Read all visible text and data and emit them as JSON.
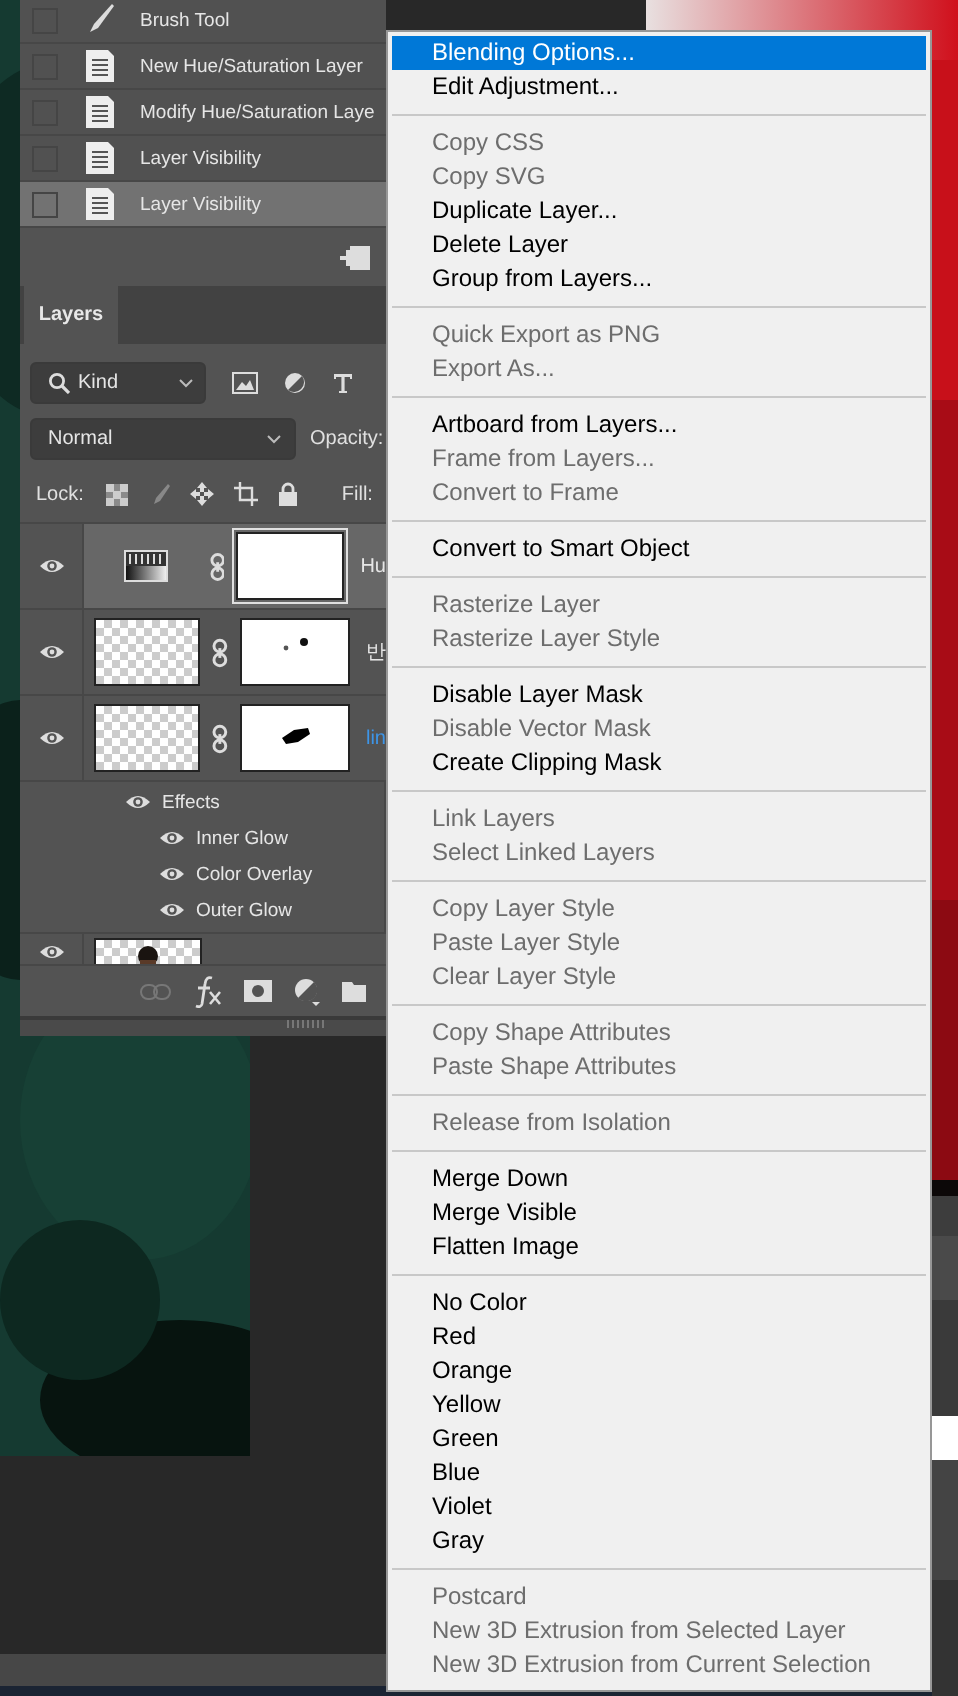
{
  "history": {
    "items": [
      {
        "label": "Brush Tool",
        "kind": "brush",
        "selected": false
      },
      {
        "label": "New Hue/Saturation Layer",
        "kind": "document",
        "selected": false
      },
      {
        "label": "Modify Hue/Saturation Laye",
        "kind": "document",
        "selected": false
      },
      {
        "label": "Layer Visibility",
        "kind": "document",
        "selected": false
      },
      {
        "label": "Layer Visibility",
        "kind": "document",
        "selected": true
      }
    ]
  },
  "layers_panel": {
    "tab": "Layers",
    "filter": "Kind",
    "blend_mode": "Normal",
    "opacity_label": "Opacity:",
    "lock_label": "Lock:",
    "fill_label": "Fill:",
    "layers": [
      {
        "kind": "adjustment",
        "name": "Hu",
        "visible": true,
        "selected": true,
        "highlighted": false
      },
      {
        "kind": "dots-mask",
        "name": "반",
        "visible": true,
        "selected": false,
        "highlighted": false
      },
      {
        "kind": "blob-mask",
        "name": "lin",
        "visible": true,
        "selected": false,
        "highlighted": true,
        "effects_label": "Effects",
        "effects": [
          "Inner Glow",
          "Color Overlay",
          "Outer Glow"
        ]
      },
      {
        "kind": "pixel",
        "visible": true,
        "selected": false
      }
    ]
  },
  "context_menu": {
    "groups": [
      [
        {
          "label": "Blending Options...",
          "disabled": false,
          "selected": true
        },
        {
          "label": "Edit Adjustment...",
          "disabled": false,
          "selected": false
        }
      ],
      [
        {
          "label": "Copy CSS",
          "disabled": true,
          "selected": false
        },
        {
          "label": "Copy SVG",
          "disabled": true,
          "selected": false
        },
        {
          "label": "Duplicate Layer...",
          "disabled": false,
          "selected": false
        },
        {
          "label": "Delete Layer",
          "disabled": false,
          "selected": false
        },
        {
          "label": "Group from Layers...",
          "disabled": false,
          "selected": false
        }
      ],
      [
        {
          "label": "Quick Export as PNG",
          "disabled": true,
          "selected": false
        },
        {
          "label": "Export As...",
          "disabled": true,
          "selected": false
        }
      ],
      [
        {
          "label": "Artboard from Layers...",
          "disabled": false,
          "selected": false
        },
        {
          "label": "Frame from Layers...",
          "disabled": true,
          "selected": false
        },
        {
          "label": "Convert to Frame",
          "disabled": true,
          "selected": false
        }
      ],
      [
        {
          "label": "Convert to Smart Object",
          "disabled": false,
          "selected": false
        }
      ],
      [
        {
          "label": "Rasterize Layer",
          "disabled": true,
          "selected": false
        },
        {
          "label": "Rasterize Layer Style",
          "disabled": true,
          "selected": false
        }
      ],
      [
        {
          "label": "Disable Layer Mask",
          "disabled": false,
          "selected": false
        },
        {
          "label": "Disable Vector Mask",
          "disabled": true,
          "selected": false
        },
        {
          "label": "Create Clipping Mask",
          "disabled": false,
          "selected": false
        }
      ],
      [
        {
          "label": "Link Layers",
          "disabled": true,
          "selected": false
        },
        {
          "label": "Select Linked Layers",
          "disabled": true,
          "selected": false
        }
      ],
      [
        {
          "label": "Copy Layer Style",
          "disabled": true,
          "selected": false
        },
        {
          "label": "Paste Layer Style",
          "disabled": true,
          "selected": false
        },
        {
          "label": "Clear Layer Style",
          "disabled": true,
          "selected": false
        }
      ],
      [
        {
          "label": "Copy Shape Attributes",
          "disabled": true,
          "selected": false
        },
        {
          "label": "Paste Shape Attributes",
          "disabled": true,
          "selected": false
        }
      ],
      [
        {
          "label": "Release from Isolation",
          "disabled": true,
          "selected": false
        }
      ],
      [
        {
          "label": "Merge Down",
          "disabled": false,
          "selected": false
        },
        {
          "label": "Merge Visible",
          "disabled": false,
          "selected": false
        },
        {
          "label": "Flatten Image",
          "disabled": false,
          "selected": false
        }
      ],
      [
        {
          "label": "No Color",
          "disabled": false,
          "selected": false
        },
        {
          "label": "Red",
          "disabled": false,
          "selected": false
        },
        {
          "label": "Orange",
          "disabled": false,
          "selected": false
        },
        {
          "label": "Yellow",
          "disabled": false,
          "selected": false
        },
        {
          "label": "Green",
          "disabled": false,
          "selected": false
        },
        {
          "label": "Blue",
          "disabled": false,
          "selected": false
        },
        {
          "label": "Violet",
          "disabled": false,
          "selected": false
        },
        {
          "label": "Gray",
          "disabled": false,
          "selected": false
        }
      ],
      [
        {
          "label": "Postcard",
          "disabled": true,
          "selected": false
        },
        {
          "label": "New 3D Extrusion from Selected Layer",
          "disabled": true,
          "selected": false
        },
        {
          "label": "New 3D Extrusion from Current Selection",
          "disabled": true,
          "selected": false
        }
      ]
    ]
  }
}
